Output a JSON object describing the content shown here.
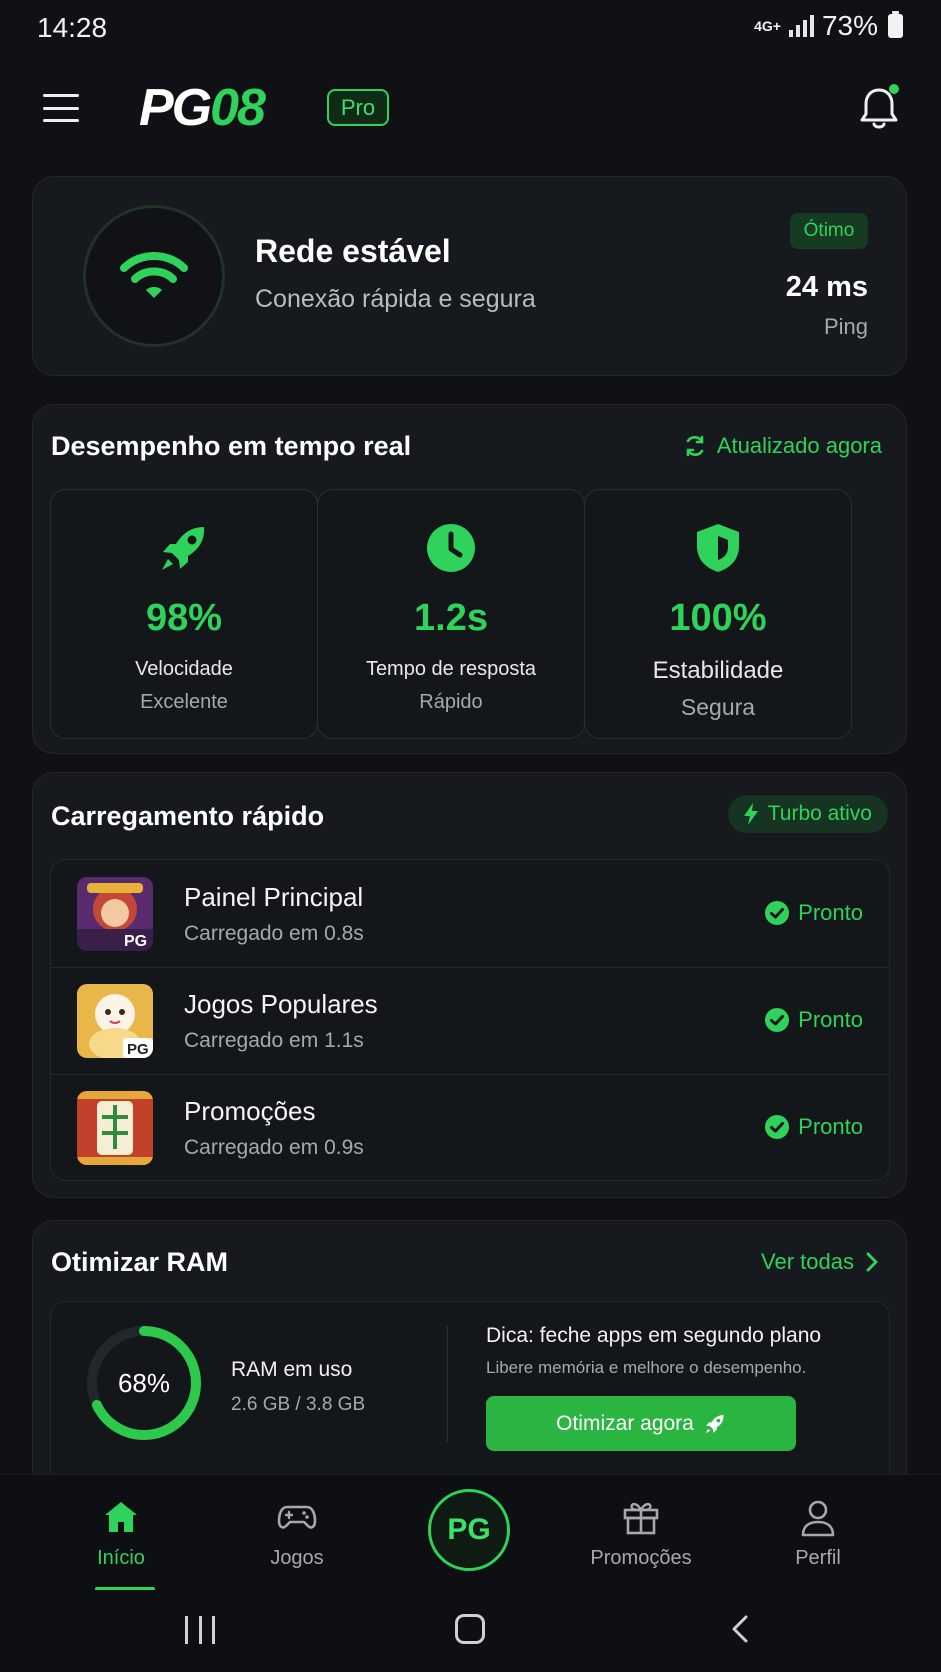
{
  "status_bar": {
    "time": "14:28",
    "network": "4G+",
    "battery": "73%"
  },
  "header": {
    "brand_prefix": "PG",
    "brand_suffix": "08",
    "pro_badge": "Pro",
    "notification_dot_color": "#2fd25a"
  },
  "network": {
    "title": "Rede estável",
    "subtitle": "Conexão rápida e segura",
    "quality": "Ótimo",
    "ping_value": "24 ms",
    "ping_label": "Ping"
  },
  "performance": {
    "title": "Desempenho em tempo real",
    "updated": "Atualizado agora",
    "metrics": [
      {
        "icon": "rocket-icon",
        "value": "98%",
        "label": "Velocidade",
        "sub": "Excelente"
      },
      {
        "icon": "clock-icon",
        "value": "1.2s",
        "label": "Tempo de resposta",
        "sub": "Rápido"
      },
      {
        "icon": "shield-icon",
        "value": "100%",
        "label": "Estabilidade",
        "sub": "Segura"
      }
    ]
  },
  "fast_loading": {
    "title": "Carregamento rápido",
    "badge": "Turbo ativo",
    "items": [
      {
        "title": "Painel Principal",
        "sub": "Carregado em 0.8s",
        "status": "Pronto"
      },
      {
        "title": "Jogos Populares",
        "sub": "Carregado em 1.1s",
        "status": "Pronto"
      },
      {
        "title": "Promoções",
        "sub": "Carregado em 0.9s",
        "status": "Pronto"
      }
    ]
  },
  "ram": {
    "title": "Otimizar RAM",
    "link": "Ver todas",
    "percent_text": "68%",
    "percent_value": 0.68,
    "label": "RAM em uso",
    "amount": "2.6 GB / 3.8 GB",
    "tip_title": "Dica: feche apps em segundo plano",
    "tip_sub": "Libere memória e melhore o desempenho.",
    "button": "Otimizar agora"
  },
  "bottom_nav": {
    "items": [
      {
        "label": "Início",
        "icon": "home-icon",
        "active": true
      },
      {
        "label": "Jogos",
        "icon": "gamepad-icon",
        "active": false
      },
      {
        "label": "Promoções",
        "icon": "gift-icon",
        "active": false
      },
      {
        "label": "Perfil",
        "icon": "user-icon",
        "active": false
      }
    ],
    "center_label": "PG"
  },
  "colors": {
    "accent": "#2fd25a",
    "background": "#0f1114",
    "card": "#16191d"
  }
}
